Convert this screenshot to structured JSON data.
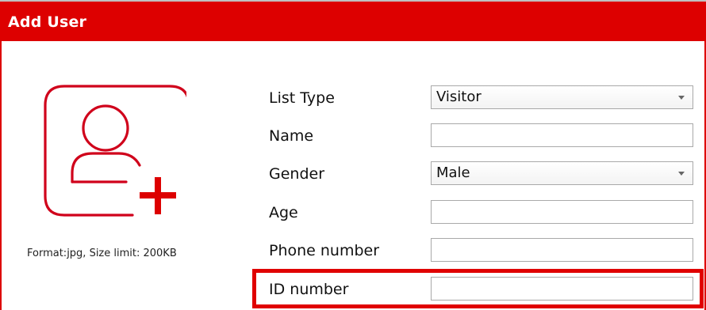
{
  "dialog": {
    "title": "Add User"
  },
  "photo": {
    "icon": "add-user-icon",
    "format_note": "Format:jpg, Size limit: 200KB",
    "accent_color": "#d0021b"
  },
  "form": {
    "list_type": {
      "label": "List Type",
      "value": "Visitor"
    },
    "name": {
      "label": "Name",
      "value": ""
    },
    "gender": {
      "label": "Gender",
      "value": "Male"
    },
    "age": {
      "label": "Age",
      "value": ""
    },
    "phone": {
      "label": "Phone number",
      "value": ""
    },
    "id_number": {
      "label": "ID number",
      "value": ""
    }
  },
  "colors": {
    "title_bar": "#dd0000",
    "highlight": "#e00000"
  }
}
